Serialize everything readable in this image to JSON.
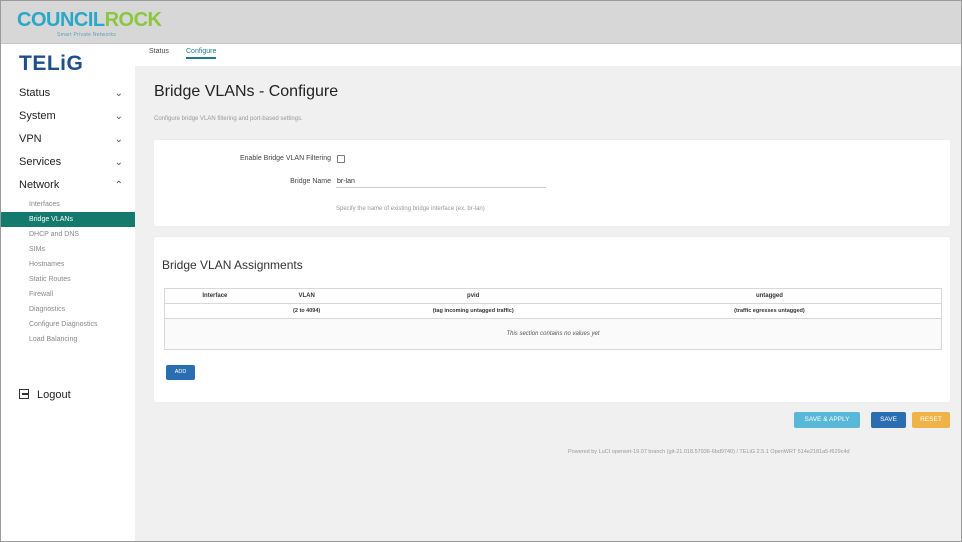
{
  "brand": {
    "name_part1": "COUNCIL",
    "name_part2": "ROCK",
    "tagline": "Smart Private Networks"
  },
  "logo": "TELiG",
  "sidebar": {
    "sections": [
      {
        "label": "Status",
        "chevron": "chevron-down"
      },
      {
        "label": "System",
        "chevron": "chevron-down"
      },
      {
        "label": "VPN",
        "chevron": "chevron-down"
      },
      {
        "label": "Services",
        "chevron": "chevron-down"
      },
      {
        "label": "Network",
        "chevron": "chevron-up"
      }
    ],
    "network_items": [
      "Interfaces",
      "Bridge VLANs",
      "DHCP and DNS",
      "SIMs",
      "Hostnames",
      "Static Routes",
      "Firewall",
      "Diagnostics",
      "Configure Diagnostics",
      "Load Balancing"
    ],
    "active_item": "Bridge VLANs",
    "logout": "Logout"
  },
  "tabs": [
    {
      "label": "Status",
      "active": false
    },
    {
      "label": "Configure",
      "active": true
    }
  ],
  "page": {
    "title": "Bridge VLANs - Configure",
    "description": "Configure bridge VLAN filtering and port-based settings."
  },
  "settings": {
    "enable_label": "Enable Bridge VLAN Filtering",
    "enable_checked": false,
    "bridge_label": "Bridge Name",
    "bridge_value": "br-lan",
    "bridge_help": "Specify the name of existing bridge interface (ex. br-lan)"
  },
  "assignments": {
    "title": "Bridge VLAN Assignments",
    "columns": [
      "Interface",
      "VLAN",
      "pvid",
      "untagged"
    ],
    "hints": [
      "",
      "(2 to 4094)",
      "(tag incoming untagged traffic)",
      "(traffic egresses untagged)"
    ],
    "empty_text": "This section contains no values yet",
    "add_label": "ADD"
  },
  "actions": {
    "apply": "SAVE & APPLY",
    "save": "SAVE",
    "reset": "RESET"
  },
  "footer": "Powered by LuCI openwrt-19.07 branch (git-21.018.57936-6bd9740) / TELiG 2.5.1 OpenWRT 514e2181a5-f629c4d",
  "colors": {
    "active_nav": "#157a6e",
    "primary_button": "#2a6db0",
    "apply_button": "#59b8d8",
    "reset_button": "#f0b34a",
    "brand_blue": "#29a8c8",
    "brand_green": "#8cc63f",
    "logo_blue": "#1f4e8c"
  }
}
